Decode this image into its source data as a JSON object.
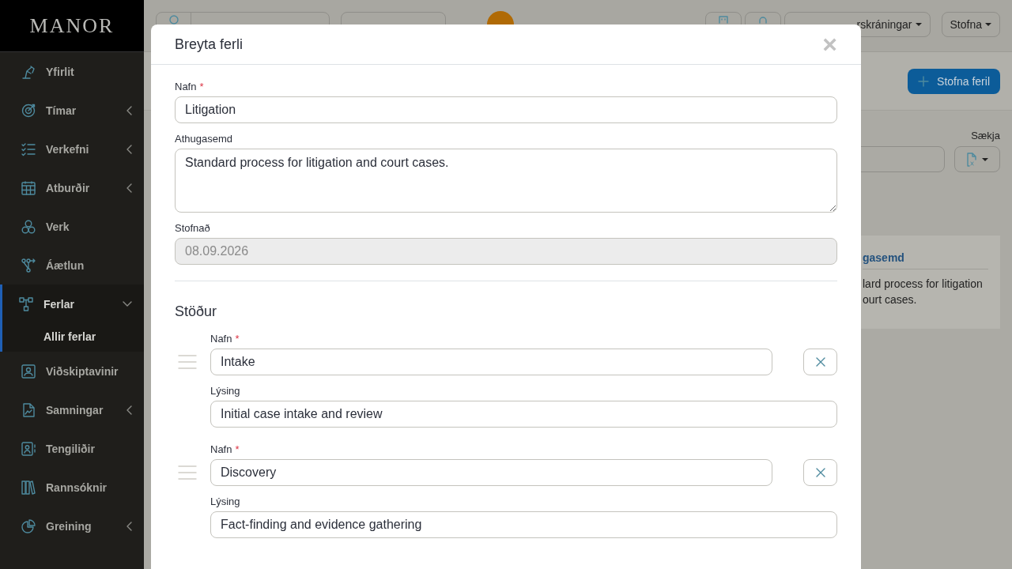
{
  "sidebar": {
    "logo": "MANOR",
    "items": [
      {
        "label": "Yfirlit",
        "expandable": false,
        "selected": false
      },
      {
        "label": "Tímar",
        "expandable": true,
        "expanded": false,
        "selected": false
      },
      {
        "label": "Verkefni",
        "expandable": true,
        "expanded": false,
        "selected": false
      },
      {
        "label": "Atburðir",
        "expandable": true,
        "expanded": false,
        "selected": false
      },
      {
        "label": "Verk",
        "expandable": false,
        "selected": false
      },
      {
        "label": "Áætlun",
        "expandable": false,
        "selected": false
      },
      {
        "label": "Ferlar",
        "expandable": true,
        "expanded": true,
        "selected": true,
        "children": [
          {
            "label": "Allir ferlar",
            "selected": true
          }
        ]
      },
      {
        "label": "Viðskiptavinir",
        "expandable": false,
        "selected": false
      },
      {
        "label": "Samningar",
        "expandable": true,
        "expanded": false,
        "selected": false
      },
      {
        "label": "Tengiliðir",
        "expandable": false,
        "selected": false
      },
      {
        "label": "Rannsóknir",
        "expandable": false,
        "selected": false
      },
      {
        "label": "Greining",
        "expandable": true,
        "expanded": false,
        "selected": false
      }
    ]
  },
  "topbar": {
    "registrations_button": "rskráningar",
    "create_button": "Stofna"
  },
  "page": {
    "create_process_button": "Stofna feril",
    "download_label": "Sækja",
    "card": {
      "heading": "gasemd",
      "text": "lard process for litigation ourt cases."
    }
  },
  "dialog": {
    "title": "Breyta ferli",
    "close": "×",
    "fields": [
      {
        "label": "Nafn",
        "required_mark": "*",
        "kind": "input",
        "value": "Litigation",
        "disabled": false
      },
      {
        "label": "Athugasemd",
        "kind": "textarea",
        "value": "Standard process for litigation and court cases.",
        "disabled": false
      },
      {
        "label": "Stofnað",
        "kind": "input",
        "value": "08.09.2026",
        "disabled": true
      }
    ],
    "statuses_heading": "Stöður",
    "statuses": [
      {
        "name_label": "Nafn",
        "name_required_mark": "*",
        "name": "Intake",
        "description_label": "Lýsing",
        "description": "Initial case intake and review"
      },
      {
        "name_label": "Nafn",
        "name_required_mark": "*",
        "name": "Discovery",
        "description_label": "Lýsing",
        "description": "Fact-finding and evidence gathering"
      }
    ]
  }
}
